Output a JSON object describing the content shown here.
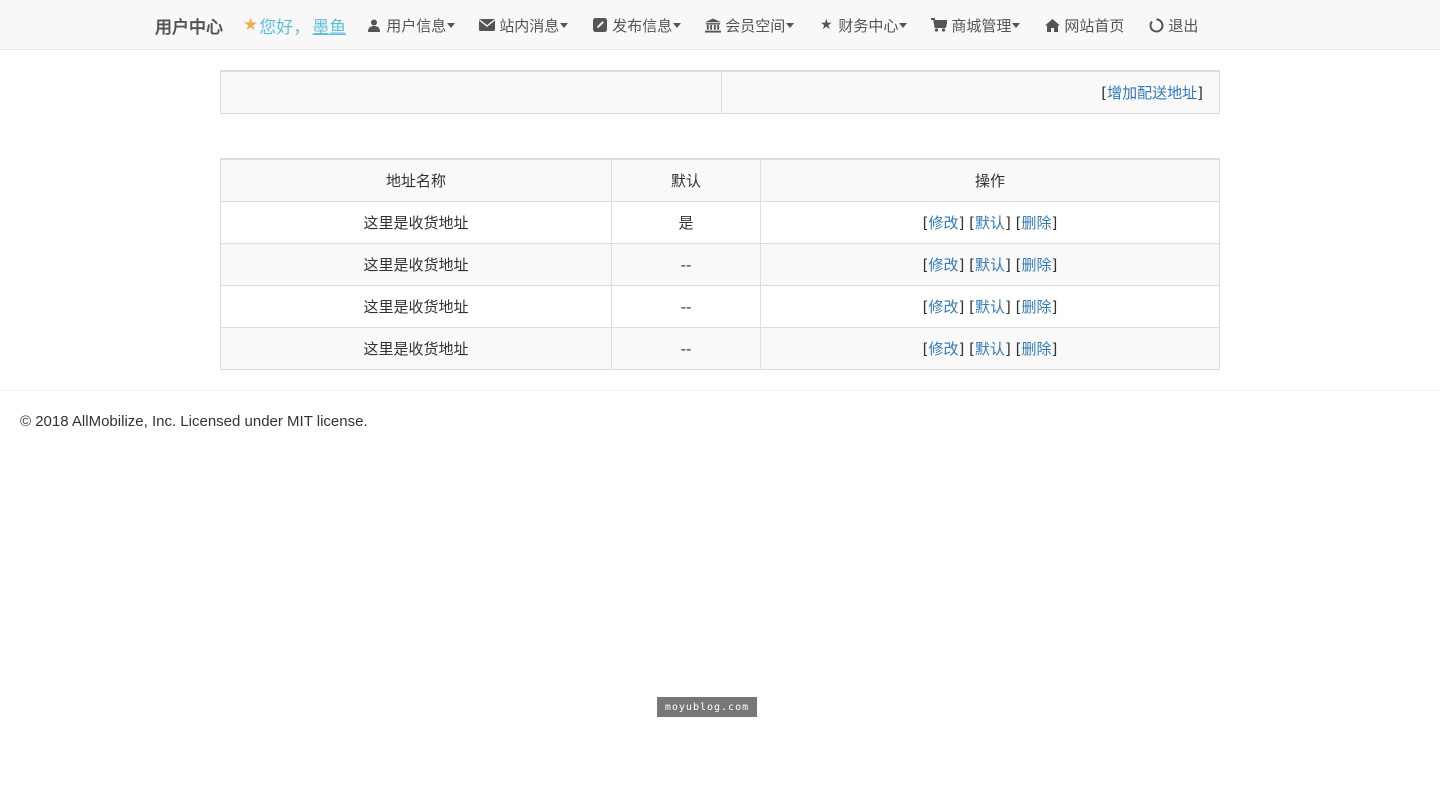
{
  "navbar": {
    "brand": "用户中心",
    "greeting_prefix": "您好，",
    "username": "墨鱼",
    "items": [
      {
        "icon": "user-icon",
        "label": "用户信息",
        "dropdown": true
      },
      {
        "icon": "envelope-icon",
        "label": "站内消息",
        "dropdown": true
      },
      {
        "icon": "edit-icon",
        "label": "发布信息",
        "dropdown": true
      },
      {
        "icon": "bank-icon",
        "label": "会员空间",
        "dropdown": true
      },
      {
        "icon": "star-icon",
        "label": "财务中心",
        "dropdown": true
      },
      {
        "icon": "cart-icon",
        "label": "商城管理",
        "dropdown": true
      },
      {
        "icon": "home-icon",
        "label": "网站首页",
        "dropdown": false
      },
      {
        "icon": "power-icon",
        "label": "退出",
        "dropdown": false
      }
    ]
  },
  "toolbar": {
    "add_address": "增加配送地址"
  },
  "table": {
    "headers": [
      "地址名称",
      "默认",
      "操作"
    ],
    "action_labels": {
      "edit": "修改",
      "default": "默认",
      "delete": "删除"
    },
    "rows": [
      {
        "address": "这里是收货地址",
        "is_default": "是"
      },
      {
        "address": "这里是收货地址",
        "is_default": "--"
      },
      {
        "address": "这里是收货地址",
        "is_default": "--"
      },
      {
        "address": "这里是收货地址",
        "is_default": "--"
      }
    ]
  },
  "footer": {
    "text": "© 2018 AllMobilize, Inc. Licensed under MIT license."
  },
  "watermark": "moyublog.com",
  "colors": {
    "link": "#337ab7",
    "greeting": "#5bc0de",
    "star": "#f0ad4e",
    "navbar_bg": "#f8f8f8"
  }
}
